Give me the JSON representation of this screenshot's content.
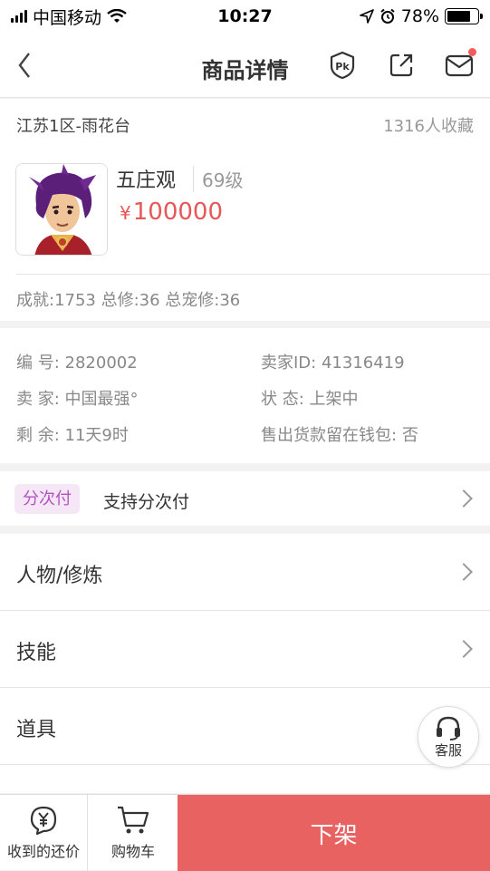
{
  "status_bar": {
    "carrier": "中国移动",
    "time": "10:27",
    "battery": "78%",
    "battery_level": 0.78
  },
  "nav": {
    "title": "商品详情",
    "icons": [
      "back-icon",
      "pk-icon",
      "share-icon",
      "mail-icon"
    ]
  },
  "item": {
    "server": "江苏1区-雨花台",
    "favorites": "1316人收藏",
    "name": "五庄观",
    "level": "69级",
    "price_symbol": "¥",
    "price": "100000",
    "stats": "成就:1753 总修:36 总宠修:36"
  },
  "info": {
    "id_label": "编 号:",
    "id_value": "2820002",
    "seller_id_label": "卖家ID:",
    "seller_id_value": "41316419",
    "seller_label": "卖 家:",
    "seller_value": "中国最强°",
    "status_label": "状 态:",
    "status_value": "上架中",
    "remaining_label": "剩 余:",
    "remaining_value": "11天9时",
    "wallet_label": "售出货款留在钱包:",
    "wallet_value": "否"
  },
  "installment": {
    "badge": "分次付",
    "text": "支持分次付"
  },
  "menu": [
    {
      "label": "人物/修炼"
    },
    {
      "label": "技能"
    },
    {
      "label": "道具"
    }
  ],
  "customer_service": {
    "label": "客服"
  },
  "bottom": {
    "offers_label": "收到的还价",
    "cart_label": "购物车",
    "action_label": "下架"
  },
  "colors": {
    "accent": "#e86262",
    "price": "#e85757",
    "badge_bg": "#f6e7f7",
    "badge_text": "#b253c0",
    "notify_dot": "#f45a5a"
  }
}
